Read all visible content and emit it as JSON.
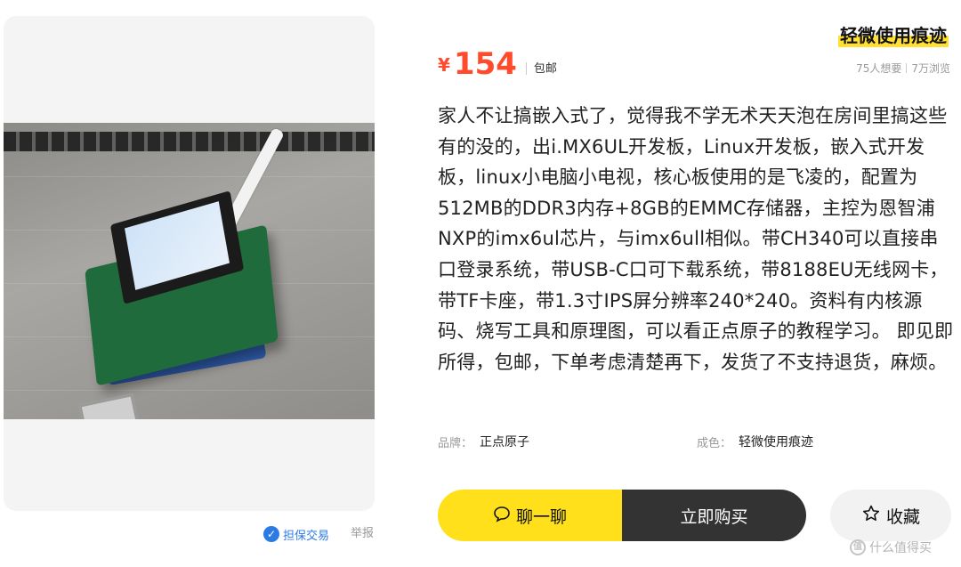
{
  "product": {
    "seller_name": "轻微使用痕迹",
    "currency": "¥",
    "price": "154",
    "shipping": "包邮",
    "wants": "75人想要",
    "views": "7万浏览",
    "description": "家人不让搞嵌入式了，觉得我不学无术天天泡在房间里搞这些有的没的，出i.MX6UL开发板，Linux开发板，嵌入式开发板，linux小电脑小电视，核心板使用的是飞凌的，配置为512MB的DDR3内存+8GB的EMMC存储器，主控为恩智浦NXP的imx6ul芯片，与imx6ull相似。带CH340可以直接串口登录系统，带USB-C口可下载系统，带8188EU无线网卡，带TF卡座，带1.3寸IPS屏分辨率240*240。资料有内核源码、烧写工具和原理图，可以看正点原子的教程学习。 即见即所得，包邮，下单考虑清楚再下，发货了不支持退货，麻烦。",
    "attrs": {
      "brand_label": "品牌：",
      "brand_value": "正点原子",
      "condition_label": "成色：",
      "condition_value": "轻微使用痕迹"
    }
  },
  "trust": {
    "guarantee_label": "担保交易",
    "report_label": "举报"
  },
  "actions": {
    "chat_label": "聊一聊",
    "buy_label": "立即购买",
    "favorite_label": "收藏"
  },
  "watermark": {
    "text": "什么值得买"
  },
  "colors": {
    "accent_yellow": "#ffe01a",
    "price_red": "#ff4b2b",
    "dark_button": "#333333",
    "link_blue": "#2c7be5"
  },
  "icons": {
    "chat": "chat-bubble-icon",
    "favorite": "star-outline-icon",
    "guarantee": "shield-check-icon"
  }
}
